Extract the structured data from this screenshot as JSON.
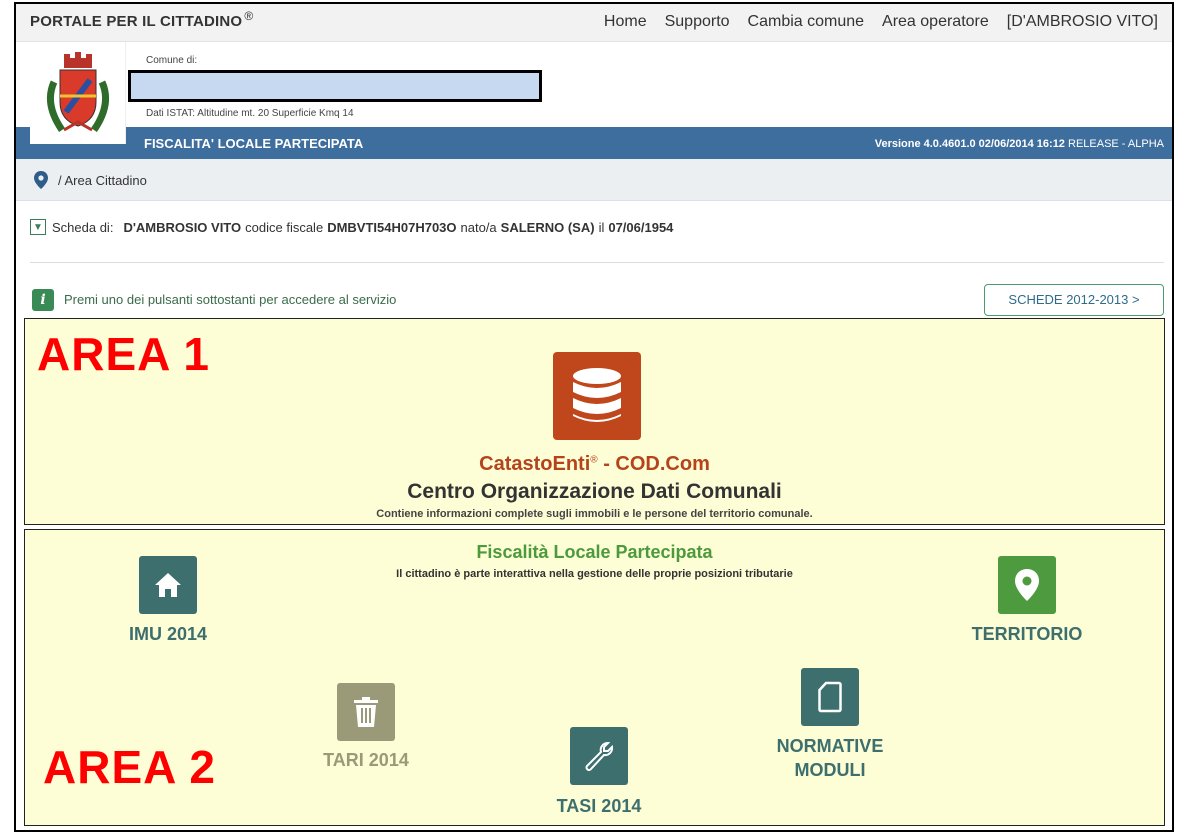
{
  "nav": {
    "brand": "PORTALE PER IL CITTADINO",
    "brand_mark": "®",
    "links": [
      "Home",
      "Supporto",
      "Cambia comune",
      "Area operatore",
      "[D'AMBROSIO VITO]"
    ]
  },
  "header": {
    "comune_label": "Comune di:",
    "comune_name": "",
    "istat": "Dati ISTAT: Altitudine mt. 20 Superficie Kmq 14"
  },
  "bar": {
    "title": "FISCALITA' LOCALE PARTECIPATA",
    "version": "Versione 4.0.4601.0 02/06/2014 16:12",
    "release": "RELEASE - ALPHA"
  },
  "breadcrumb": {
    "text": "/ Area Cittadino"
  },
  "scheda": {
    "label": "Scheda di:",
    "name": "D'AMBROSIO VITO",
    "cf_label": "codice fiscale",
    "cf": "DMBVTI54H07H703O",
    "born_label": "nato/a",
    "born_place": "SALERNO (SA)",
    "date_label": "il",
    "date": "07/06/1954"
  },
  "info": {
    "text": "Premi uno dei pulsanti sottostanti per accedere al servizio",
    "button": "SCHEDE 2012-2013 >"
  },
  "area1": {
    "label": "AREA 1",
    "title": "CatastoEnti",
    "title_mark": "®",
    "title_suffix": " - COD.Com",
    "subtitle": "Centro Organizzazione Dati Comunali",
    "description": "Contiene informazioni complete sugli immobili e le persone del territorio comunale."
  },
  "area2": {
    "label": "AREA 2",
    "title": "Fiscalità Locale Partecipata",
    "subtitle": "Il cittadino è parte interattiva nella gestione delle proprie posizioni tributarie",
    "tiles": {
      "imu": "IMU 2014",
      "territorio": "TERRITORIO",
      "tari": "TARI 2014",
      "tasi": "TASI 2014",
      "normative_1": "NORMATIVE",
      "normative_2": "MODULI"
    }
  },
  "colors": {
    "blue_bar": "#3e6e9e",
    "area_bg": "#fdfdd6",
    "catasto": "#c0461c",
    "tile_teal": "#3d6f6f",
    "tile_green": "#4e9a3e",
    "tile_faded": "#9a9a78",
    "area_label": "#ff0000"
  },
  "icons": [
    "coat-of-arms-logo",
    "map-pin-icon",
    "toggle-down-icon",
    "info-icon",
    "database-icon",
    "home-icon",
    "location-pin-icon",
    "trash-icon",
    "wrench-icon",
    "document-icon"
  ]
}
